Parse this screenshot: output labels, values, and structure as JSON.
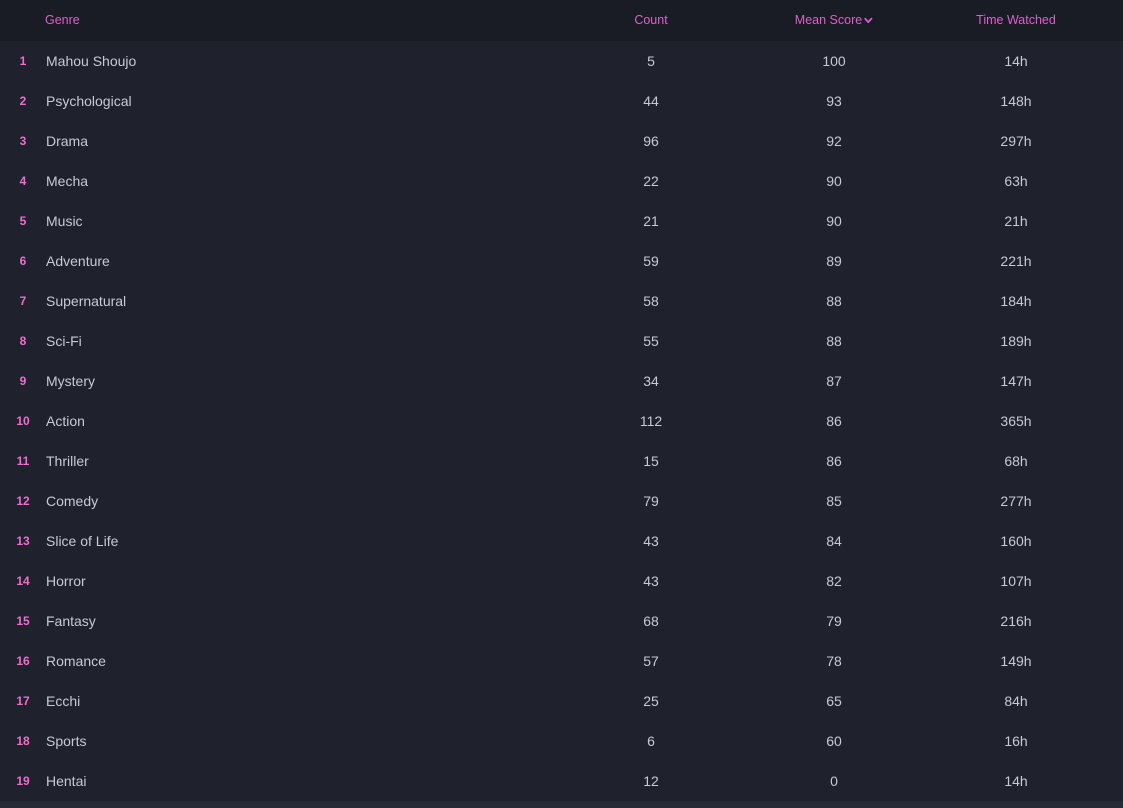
{
  "colors": {
    "background": "#1f222c",
    "header_background": "#191c25",
    "accent": "#e05ecc",
    "rank": "#f06bd2",
    "text": "#c7cad3"
  },
  "header": {
    "genre": "Genre",
    "count": "Count",
    "mean_score": "Mean Score",
    "mean_score_sort_icon": "chevron-down-icon",
    "time_watched": "Time Watched"
  },
  "rows": [
    {
      "rank": "1",
      "genre": "Mahou Shoujo",
      "count": "5",
      "mean_score": "100",
      "time_watched": "14h"
    },
    {
      "rank": "2",
      "genre": "Psychological",
      "count": "44",
      "mean_score": "93",
      "time_watched": "148h"
    },
    {
      "rank": "3",
      "genre": "Drama",
      "count": "96",
      "mean_score": "92",
      "time_watched": "297h"
    },
    {
      "rank": "4",
      "genre": "Mecha",
      "count": "22",
      "mean_score": "90",
      "time_watched": "63h"
    },
    {
      "rank": "5",
      "genre": "Music",
      "count": "21",
      "mean_score": "90",
      "time_watched": "21h"
    },
    {
      "rank": "6",
      "genre": "Adventure",
      "count": "59",
      "mean_score": "89",
      "time_watched": "221h"
    },
    {
      "rank": "7",
      "genre": "Supernatural",
      "count": "58",
      "mean_score": "88",
      "time_watched": "184h"
    },
    {
      "rank": "8",
      "genre": "Sci-Fi",
      "count": "55",
      "mean_score": "88",
      "time_watched": "189h"
    },
    {
      "rank": "9",
      "genre": "Mystery",
      "count": "34",
      "mean_score": "87",
      "time_watched": "147h"
    },
    {
      "rank": "10",
      "genre": "Action",
      "count": "112",
      "mean_score": "86",
      "time_watched": "365h"
    },
    {
      "rank": "11",
      "genre": "Thriller",
      "count": "15",
      "mean_score": "86",
      "time_watched": "68h"
    },
    {
      "rank": "12",
      "genre": "Comedy",
      "count": "79",
      "mean_score": "85",
      "time_watched": "277h"
    },
    {
      "rank": "13",
      "genre": "Slice of Life",
      "count": "43",
      "mean_score": "84",
      "time_watched": "160h"
    },
    {
      "rank": "14",
      "genre": "Horror",
      "count": "43",
      "mean_score": "82",
      "time_watched": "107h"
    },
    {
      "rank": "15",
      "genre": "Fantasy",
      "count": "68",
      "mean_score": "79",
      "time_watched": "216h"
    },
    {
      "rank": "16",
      "genre": "Romance",
      "count": "57",
      "mean_score": "78",
      "time_watched": "149h"
    },
    {
      "rank": "17",
      "genre": "Ecchi",
      "count": "25",
      "mean_score": "65",
      "time_watched": "84h"
    },
    {
      "rank": "18",
      "genre": "Sports",
      "count": "6",
      "mean_score": "60",
      "time_watched": "16h"
    },
    {
      "rank": "19",
      "genre": "Hentai",
      "count": "12",
      "mean_score": "0",
      "time_watched": "14h"
    }
  ]
}
